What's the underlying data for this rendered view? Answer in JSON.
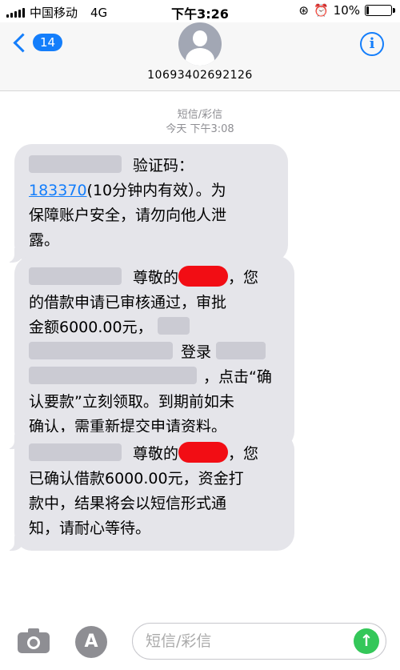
{
  "status_bar": {
    "carrier": "中国移动",
    "network": "4G",
    "time": "下午3:26",
    "battery": "10%",
    "battery_level": 0.1
  },
  "header": {
    "back_count": "14",
    "sender_number": "10693402692126"
  },
  "thread": {
    "channel": "短信/彩信",
    "date": "今天 下午3:08",
    "messages": [
      {
        "lines": [
          "验证码：",
          "183370",
          "(10分钟内有效）。为",
          "保障账户安全，请勿向他人泄",
          "露。"
        ]
      },
      {
        "lines": [
          "尊敬的",
          "，您",
          "的借款申请已审核通过，审批",
          "金额6000.00元，",
          "登录",
          "，点击“确",
          "认要款”立刻领取。到期前如未",
          "确认，需重新提交申请资料。"
        ]
      },
      {
        "lines": [
          "尊敬的",
          "，您",
          "已确认借款6000.00元，资金打",
          "款中，结果将会以短信形式通",
          "知，请耐心等待。"
        ]
      }
    ]
  },
  "composer": {
    "placeholder": "短信/彩信",
    "icons": [
      "camera-icon",
      "app-store-icon",
      "send-arrow-icon"
    ],
    "send_color": "#34c759"
  },
  "colors": {
    "accent": "#147efb",
    "bubble": "#e5e5ea",
    "redaction": "#f20d14"
  }
}
